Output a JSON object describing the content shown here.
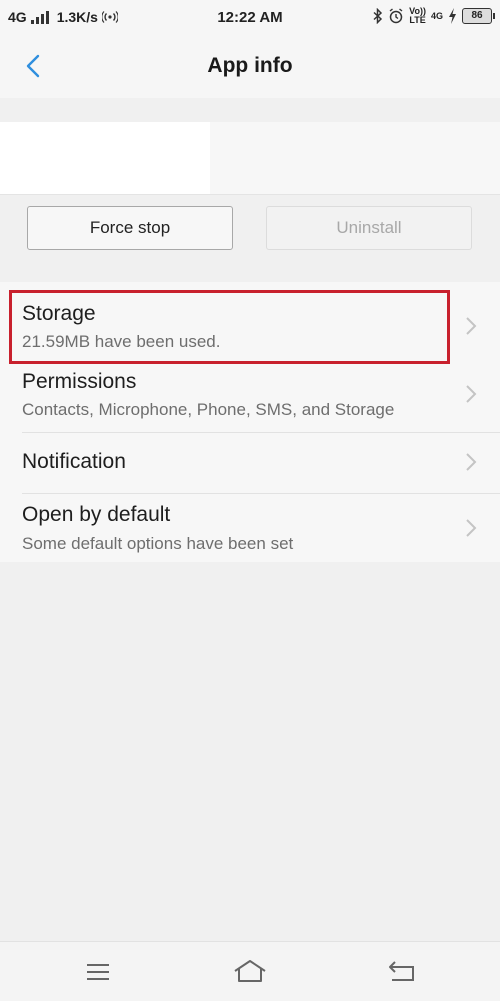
{
  "status_bar": {
    "network": "4G",
    "speed": "1.3K/s",
    "time": "12:22 AM",
    "volte_top": "Vo))",
    "volte_bottom": "LTE",
    "network_right": "4G",
    "battery": "86"
  },
  "app_bar": {
    "title": "App info",
    "back_icon": "chevron-left-icon"
  },
  "buttons": {
    "force_stop": "Force stop",
    "uninstall": "Uninstall"
  },
  "settings": {
    "items": [
      {
        "title": "Storage",
        "subtitle": "21.59MB have been used."
      },
      {
        "title": "Permissions",
        "subtitle": "Contacts, Microphone, Phone, SMS, and Storage"
      },
      {
        "title": "Notification"
      },
      {
        "title": "Open by default",
        "subtitle": "Some default options have been set"
      }
    ]
  },
  "colors": {
    "accent": "#2f8fde",
    "highlight": "#c8202d",
    "background": "#f0f0f0"
  },
  "nav_bar": {
    "icons": [
      "menu-icon",
      "home-icon",
      "back-icon"
    ]
  }
}
